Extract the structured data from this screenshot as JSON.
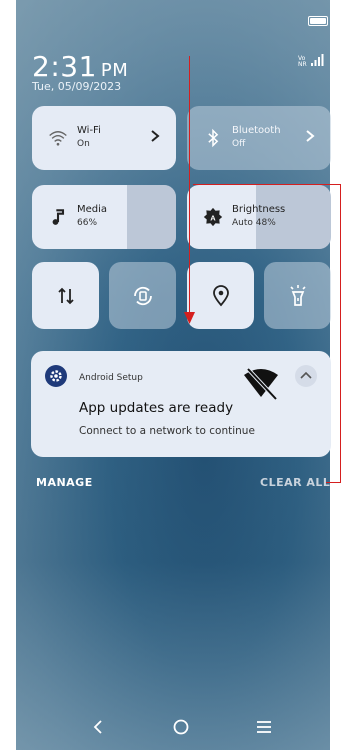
{
  "status": {
    "time_hour_min": "2:31",
    "time_ampm": "PM",
    "date": "Tue, 05/09/2023",
    "signal_volte": "Vo",
    "signal_nr": "NR",
    "battery_icon": "battery-full-icon"
  },
  "tiles": {
    "wifi": {
      "label": "Wi-Fi",
      "sub": "On",
      "icon": "wifi-icon"
    },
    "bluetooth": {
      "label": "Bluetooth",
      "sub": "Off",
      "icon": "bluetooth-icon"
    },
    "media": {
      "label": "Media",
      "sub": "66%",
      "icon": "music-note-icon",
      "level": 0.66
    },
    "brightness": {
      "label": "Brightness",
      "sub": "Auto 48%",
      "icon": "brightness-auto-icon",
      "level": 0.48
    }
  },
  "round_tiles": [
    {
      "name": "data-toggle",
      "icon": "mobile-data-icon",
      "active": true
    },
    {
      "name": "auto-rotate",
      "icon": "auto-rotate-icon",
      "active": false
    },
    {
      "name": "location",
      "icon": "location-pin-icon",
      "active": true
    },
    {
      "name": "flashlight",
      "icon": "flashlight-icon",
      "active": false
    }
  ],
  "notification": {
    "app": "Android Setup",
    "title": "App updates are ready",
    "body": "Connect to a network to continue",
    "icon": "gear-icon",
    "status_icon": "wifi-off-icon"
  },
  "actions": {
    "manage": "MANAGE",
    "clear_all": "CLEAR ALL"
  },
  "nav": {
    "back": "back-icon",
    "home": "home-icon",
    "recents": "recents-icon"
  }
}
